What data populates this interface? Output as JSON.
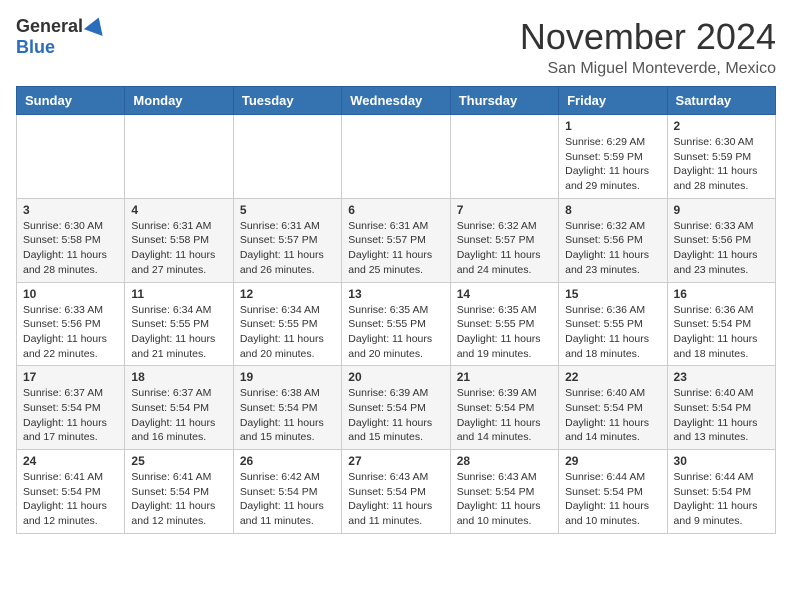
{
  "header": {
    "logo": {
      "general": "General",
      "blue": "Blue"
    },
    "title": "November 2024",
    "location": "San Miguel Monteverde, Mexico"
  },
  "weekdays": [
    "Sunday",
    "Monday",
    "Tuesday",
    "Wednesday",
    "Thursday",
    "Friday",
    "Saturday"
  ],
  "weeks": [
    [
      {
        "day": "",
        "sunrise": "",
        "sunset": "",
        "daylight": ""
      },
      {
        "day": "",
        "sunrise": "",
        "sunset": "",
        "daylight": ""
      },
      {
        "day": "",
        "sunrise": "",
        "sunset": "",
        "daylight": ""
      },
      {
        "day": "",
        "sunrise": "",
        "sunset": "",
        "daylight": ""
      },
      {
        "day": "",
        "sunrise": "",
        "sunset": "",
        "daylight": ""
      },
      {
        "day": "1",
        "sunrise": "Sunrise: 6:29 AM",
        "sunset": "Sunset: 5:59 PM",
        "daylight": "Daylight: 11 hours and 29 minutes."
      },
      {
        "day": "2",
        "sunrise": "Sunrise: 6:30 AM",
        "sunset": "Sunset: 5:59 PM",
        "daylight": "Daylight: 11 hours and 28 minutes."
      }
    ],
    [
      {
        "day": "3",
        "sunrise": "Sunrise: 6:30 AM",
        "sunset": "Sunset: 5:58 PM",
        "daylight": "Daylight: 11 hours and 28 minutes."
      },
      {
        "day": "4",
        "sunrise": "Sunrise: 6:31 AM",
        "sunset": "Sunset: 5:58 PM",
        "daylight": "Daylight: 11 hours and 27 minutes."
      },
      {
        "day": "5",
        "sunrise": "Sunrise: 6:31 AM",
        "sunset": "Sunset: 5:57 PM",
        "daylight": "Daylight: 11 hours and 26 minutes."
      },
      {
        "day": "6",
        "sunrise": "Sunrise: 6:31 AM",
        "sunset": "Sunset: 5:57 PM",
        "daylight": "Daylight: 11 hours and 25 minutes."
      },
      {
        "day": "7",
        "sunrise": "Sunrise: 6:32 AM",
        "sunset": "Sunset: 5:57 PM",
        "daylight": "Daylight: 11 hours and 24 minutes."
      },
      {
        "day": "8",
        "sunrise": "Sunrise: 6:32 AM",
        "sunset": "Sunset: 5:56 PM",
        "daylight": "Daylight: 11 hours and 23 minutes."
      },
      {
        "day": "9",
        "sunrise": "Sunrise: 6:33 AM",
        "sunset": "Sunset: 5:56 PM",
        "daylight": "Daylight: 11 hours and 23 minutes."
      }
    ],
    [
      {
        "day": "10",
        "sunrise": "Sunrise: 6:33 AM",
        "sunset": "Sunset: 5:56 PM",
        "daylight": "Daylight: 11 hours and 22 minutes."
      },
      {
        "day": "11",
        "sunrise": "Sunrise: 6:34 AM",
        "sunset": "Sunset: 5:55 PM",
        "daylight": "Daylight: 11 hours and 21 minutes."
      },
      {
        "day": "12",
        "sunrise": "Sunrise: 6:34 AM",
        "sunset": "Sunset: 5:55 PM",
        "daylight": "Daylight: 11 hours and 20 minutes."
      },
      {
        "day": "13",
        "sunrise": "Sunrise: 6:35 AM",
        "sunset": "Sunset: 5:55 PM",
        "daylight": "Daylight: 11 hours and 20 minutes."
      },
      {
        "day": "14",
        "sunrise": "Sunrise: 6:35 AM",
        "sunset": "Sunset: 5:55 PM",
        "daylight": "Daylight: 11 hours and 19 minutes."
      },
      {
        "day": "15",
        "sunrise": "Sunrise: 6:36 AM",
        "sunset": "Sunset: 5:55 PM",
        "daylight": "Daylight: 11 hours and 18 minutes."
      },
      {
        "day": "16",
        "sunrise": "Sunrise: 6:36 AM",
        "sunset": "Sunset: 5:54 PM",
        "daylight": "Daylight: 11 hours and 18 minutes."
      }
    ],
    [
      {
        "day": "17",
        "sunrise": "Sunrise: 6:37 AM",
        "sunset": "Sunset: 5:54 PM",
        "daylight": "Daylight: 11 hours and 17 minutes."
      },
      {
        "day": "18",
        "sunrise": "Sunrise: 6:37 AM",
        "sunset": "Sunset: 5:54 PM",
        "daylight": "Daylight: 11 hours and 16 minutes."
      },
      {
        "day": "19",
        "sunrise": "Sunrise: 6:38 AM",
        "sunset": "Sunset: 5:54 PM",
        "daylight": "Daylight: 11 hours and 15 minutes."
      },
      {
        "day": "20",
        "sunrise": "Sunrise: 6:39 AM",
        "sunset": "Sunset: 5:54 PM",
        "daylight": "Daylight: 11 hours and 15 minutes."
      },
      {
        "day": "21",
        "sunrise": "Sunrise: 6:39 AM",
        "sunset": "Sunset: 5:54 PM",
        "daylight": "Daylight: 11 hours and 14 minutes."
      },
      {
        "day": "22",
        "sunrise": "Sunrise: 6:40 AM",
        "sunset": "Sunset: 5:54 PM",
        "daylight": "Daylight: 11 hours and 14 minutes."
      },
      {
        "day": "23",
        "sunrise": "Sunrise: 6:40 AM",
        "sunset": "Sunset: 5:54 PM",
        "daylight": "Daylight: 11 hours and 13 minutes."
      }
    ],
    [
      {
        "day": "24",
        "sunrise": "Sunrise: 6:41 AM",
        "sunset": "Sunset: 5:54 PM",
        "daylight": "Daylight: 11 hours and 12 minutes."
      },
      {
        "day": "25",
        "sunrise": "Sunrise: 6:41 AM",
        "sunset": "Sunset: 5:54 PM",
        "daylight": "Daylight: 11 hours and 12 minutes."
      },
      {
        "day": "26",
        "sunrise": "Sunrise: 6:42 AM",
        "sunset": "Sunset: 5:54 PM",
        "daylight": "Daylight: 11 hours and 11 minutes."
      },
      {
        "day": "27",
        "sunrise": "Sunrise: 6:43 AM",
        "sunset": "Sunset: 5:54 PM",
        "daylight": "Daylight: 11 hours and 11 minutes."
      },
      {
        "day": "28",
        "sunrise": "Sunrise: 6:43 AM",
        "sunset": "Sunset: 5:54 PM",
        "daylight": "Daylight: 11 hours and 10 minutes."
      },
      {
        "day": "29",
        "sunrise": "Sunrise: 6:44 AM",
        "sunset": "Sunset: 5:54 PM",
        "daylight": "Daylight: 11 hours and 10 minutes."
      },
      {
        "day": "30",
        "sunrise": "Sunrise: 6:44 AM",
        "sunset": "Sunset: 5:54 PM",
        "daylight": "Daylight: 11 hours and 9 minutes."
      }
    ]
  ]
}
